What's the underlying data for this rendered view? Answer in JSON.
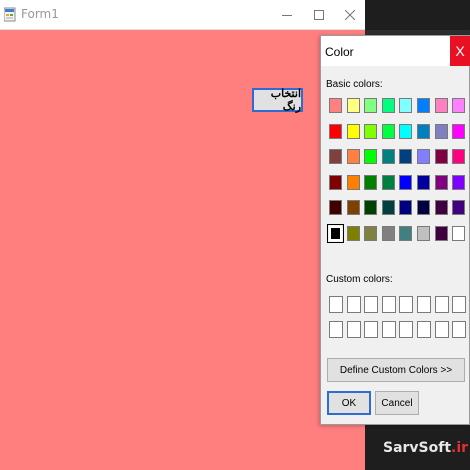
{
  "form": {
    "title": "Form1",
    "background_color": "#ff7f7f",
    "pick_color_button_label": "انتخاب رنگ"
  },
  "dialog": {
    "title": "Color",
    "close_label": "X",
    "basic_colors_label": "Basic colors:",
    "custom_colors_label": "Custom colors:",
    "define_custom_label": "Define Custom Colors >>",
    "ok_label": "OK",
    "cancel_label": "Cancel",
    "selected_color": "#000000",
    "basic_colors": [
      [
        "#ff8080",
        "#ffff80",
        "#80ff80",
        "#00ff80",
        "#80ffff",
        "#0080ff",
        "#ff80c0",
        "#ff80ff"
      ],
      [
        "#ff0000",
        "#ffff00",
        "#80ff00",
        "#00ff40",
        "#00ffff",
        "#0080c0",
        "#8080c0",
        "#ff00ff"
      ],
      [
        "#804040",
        "#ff8040",
        "#00ff00",
        "#008080",
        "#004080",
        "#8080ff",
        "#800040",
        "#ff0080"
      ],
      [
        "#800000",
        "#ff8000",
        "#008000",
        "#008040",
        "#0000ff",
        "#0000a0",
        "#800080",
        "#8000ff"
      ],
      [
        "#400000",
        "#804000",
        "#004000",
        "#004040",
        "#000080",
        "#000040",
        "#400040",
        "#400080"
      ],
      [
        "#000000",
        "#808000",
        "#808040",
        "#808080",
        "#408080",
        "#c0c0c0",
        "#400040",
        "#ffffff"
      ]
    ],
    "custom_colors": [
      [
        "#ffffff",
        "#ffffff",
        "#ffffff",
        "#ffffff",
        "#ffffff",
        "#ffffff",
        "#ffffff",
        "#ffffff"
      ],
      [
        "#ffffff",
        "#ffffff",
        "#ffffff",
        "#ffffff",
        "#ffffff",
        "#ffffff",
        "#ffffff",
        "#ffffff"
      ]
    ]
  },
  "watermark": {
    "part1": "SarvSoft",
    "part2": ".ir"
  },
  "icons": {
    "form_icon": "windows-form-icon",
    "minimize": "minimize-icon",
    "maximize": "maximize-icon",
    "close": "close-icon"
  }
}
